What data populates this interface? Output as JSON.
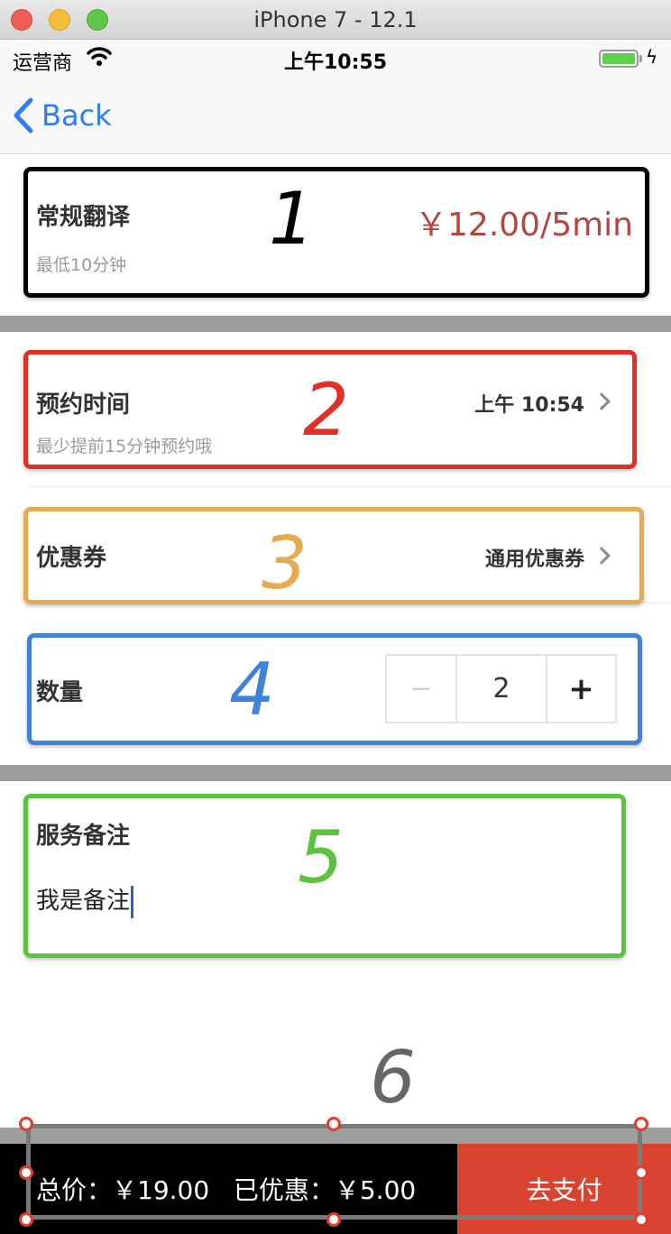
{
  "window": {
    "title": "iPhone 7 - 12.1"
  },
  "status_bar": {
    "carrier": "运营商",
    "time": "上午10:55"
  },
  "nav": {
    "back_label": "Back"
  },
  "service": {
    "title": "常规翻译",
    "subtitle": "最低10分钟",
    "price": "￥12.00/5min"
  },
  "appointment": {
    "title": "预约时间",
    "subtitle": "最少提前15分钟预约哦",
    "value": "上午 10:54"
  },
  "coupon": {
    "title": "优惠券",
    "value": "通用优惠券"
  },
  "quantity": {
    "title": "数量",
    "minus": "−",
    "value": "2",
    "plus": "+"
  },
  "remark": {
    "title": "服务备注",
    "text": "我是备注"
  },
  "footer": {
    "total": "总价：￥19.00",
    "discount": "已优惠：￥5.00",
    "pay_label": "去支付"
  },
  "annotations": [
    "1",
    "2",
    "3",
    "4",
    "5",
    "6"
  ],
  "colors": {
    "accent_blue": "#2f7cf6",
    "price_red": "#b5463f",
    "pay_red": "#d94430",
    "box1": "#000000",
    "box2": "#e03128",
    "box3": "#e3ac53",
    "box4": "#3f82d8",
    "box5": "#5cc23f"
  }
}
